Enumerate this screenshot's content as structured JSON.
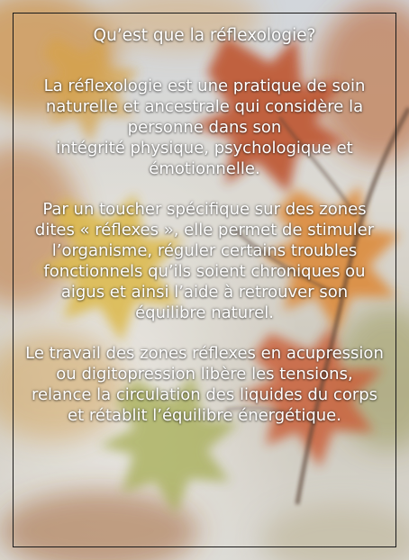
{
  "title": "Qu’est que la réflexologie?",
  "paragraphs": [
    {
      "lines": [
        "La réflexologie est une pratique de soin",
        "naturelle et ancestrale qui considère la",
        "personne dans son",
        "intégrité physique, psychologique et",
        "émotionnelle."
      ]
    },
    {
      "lines": [
        "Par un toucher spécifique sur des zones",
        "dites « réflexes », elle permet de stimuler",
        "l’organisme, réguler certains troubles",
        "fonctionnels qu’ils soient chroniques ou",
        "aigus et ainsi l’aide à retrouver son",
        "équilibre naturel."
      ]
    },
    {
      "lines": [
        "Le travail des zones réflexes en acupression",
        "ou digitopression libère les tensions,",
        "relance la circulation des liquides du corps",
        "et rétablit l’équilibre énergétique."
      ]
    }
  ],
  "background": {
    "image_subject": "autumn-maple-leaves",
    "colors": {
      "leaf_red": "#b8461f",
      "leaf_orange": "#d9822b",
      "leaf_yellow": "#d9b33a",
      "leaf_green": "#8f9a3a",
      "sky": "#cfd3d8",
      "text": "#ffffff",
      "frame": "#1a1a1a"
    }
  }
}
